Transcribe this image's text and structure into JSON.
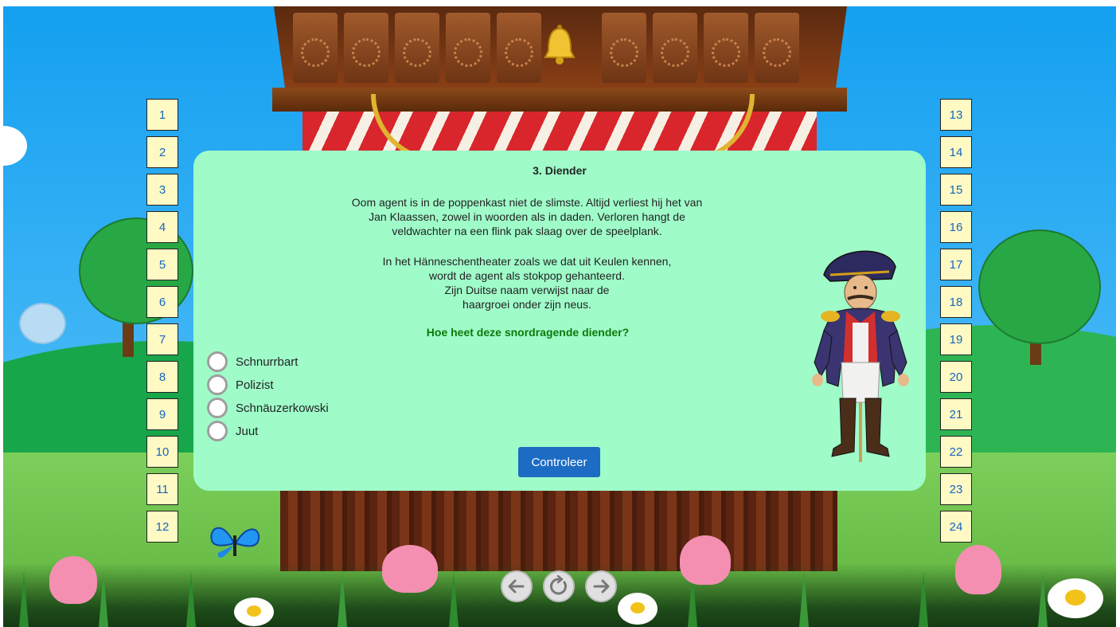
{
  "quiz": {
    "title": "3. Diender",
    "paragraph1": [
      "Oom agent is in de poppenkast niet de slimste. Altijd verliest hij het van",
      "Jan Klaassen, zowel in woorden als in daden. Verloren hangt de",
      "veldwachter na een flink pak slaag over de speelplank."
    ],
    "paragraph2": [
      "In het Hänneschentheater zoals we dat uit Keulen kennen,",
      "wordt de agent als stokpop gehanteerd.",
      "Zijn Duitse naam verwijst naar de",
      "haargroei onder zijn neus."
    ],
    "question": "Hoe heet deze snordragende diender?",
    "options": [
      "Schnurrbart",
      "Polizist",
      "Schnäuzerkowski",
      "Juut"
    ],
    "check_label": "Controleer"
  },
  "nav_left": [
    "1",
    "2",
    "3",
    "4",
    "5",
    "6",
    "7",
    "8",
    "9",
    "10",
    "11",
    "12"
  ],
  "nav_right": [
    "13",
    "14",
    "15",
    "16",
    "17",
    "18",
    "19",
    "20",
    "21",
    "22",
    "23",
    "24"
  ],
  "bottom_nav": {
    "prev_icon": "arrow-left-icon",
    "reset_icon": "reload-icon",
    "next_icon": "arrow-right-icon"
  },
  "colors": {
    "card": "#9ffcc9",
    "question": "#0a7a0a",
    "button": "#1d6cc4",
    "tile": "#fff9c4",
    "tile_text": "#1565c0"
  }
}
